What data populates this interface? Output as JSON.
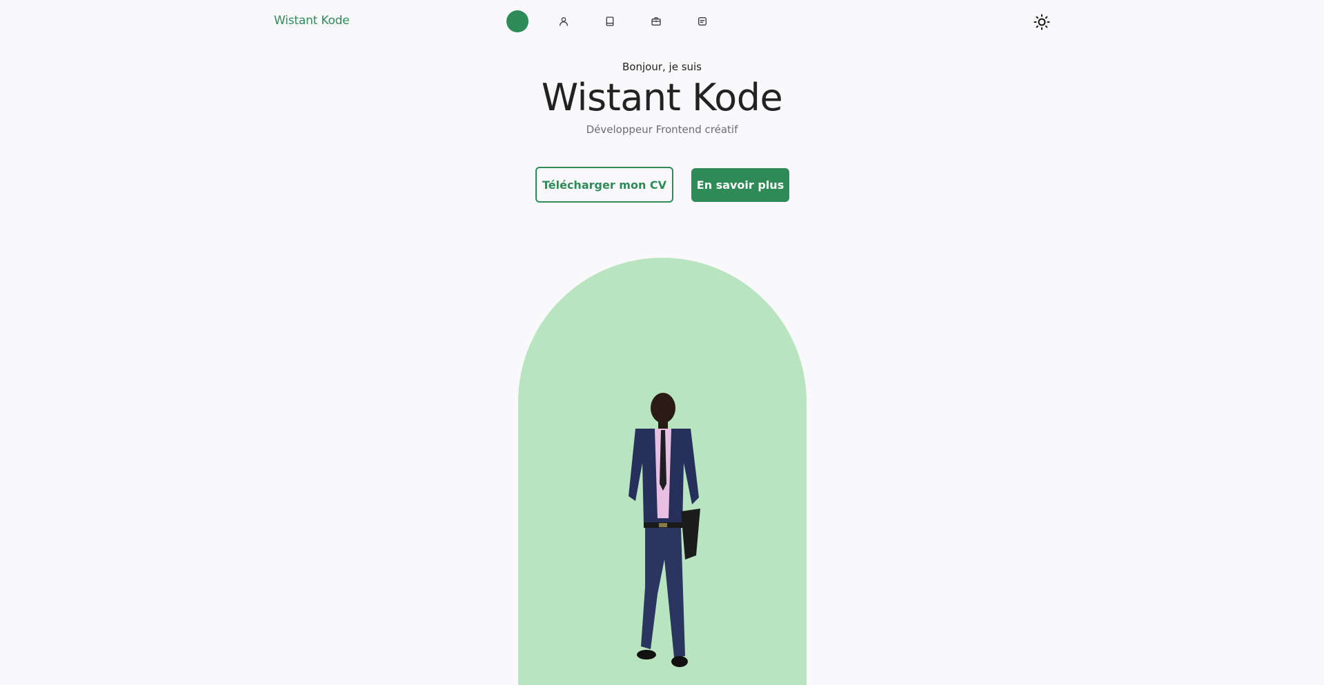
{
  "header": {
    "logo": "Wistant Kode",
    "nav": [
      {
        "icon": "home-icon",
        "active": true
      },
      {
        "icon": "user-icon",
        "active": false
      },
      {
        "icon": "book-icon",
        "active": false
      },
      {
        "icon": "briefcase-icon",
        "active": false
      },
      {
        "icon": "message-icon",
        "active": false
      }
    ],
    "theme_toggle_icon": "sun-icon"
  },
  "hero": {
    "greeting": "Bonjour, je suis",
    "name": "Wistant Kode",
    "role": "Développeur Frontend créatif",
    "download_cv_label": "Télécharger mon CV",
    "learn_more_label": "En savoir plus",
    "portrait_icon": "person-photo"
  },
  "colors": {
    "accent": "#2e8b57",
    "arch_background": "#b8e4c0",
    "page_background": "#f9f9fb"
  }
}
